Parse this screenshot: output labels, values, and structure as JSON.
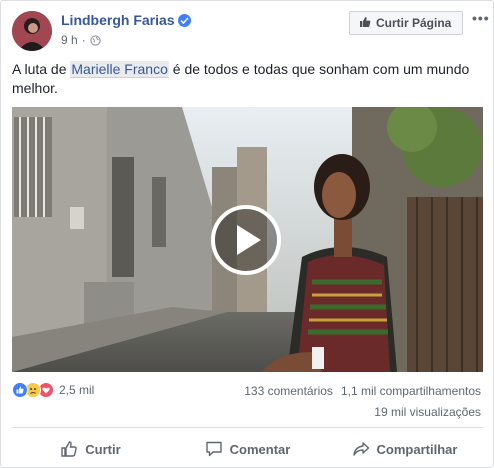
{
  "header": {
    "author_name": "Lindbergh Farias",
    "time": "9 h",
    "separator": "·",
    "like_page_label": "Curtir Página",
    "more_label": "•••"
  },
  "post": {
    "text_before": "A luta de ",
    "mention": "Marielle Franco",
    "text_after": " é de todos e todas que sonham com um mundo melhor."
  },
  "footer": {
    "reaction_count": "2,5 mil",
    "comments": "133 comentários",
    "shares": "1,1 mil compartilhamentos",
    "views": "19 mil visualizações"
  },
  "actions": {
    "like": "Curtir",
    "comment": "Comentar",
    "share": "Compartilhar"
  },
  "colors": {
    "link_blue": "#385898",
    "verified_blue": "#4080ff",
    "meta_grey": "#606770"
  },
  "icons": [
    "verified-badge-icon",
    "globe-icon",
    "thumbs-up-icon",
    "play-icon",
    "like-reaction-icon",
    "sad-reaction-icon",
    "love-reaction-icon",
    "comment-icon",
    "share-icon"
  ]
}
